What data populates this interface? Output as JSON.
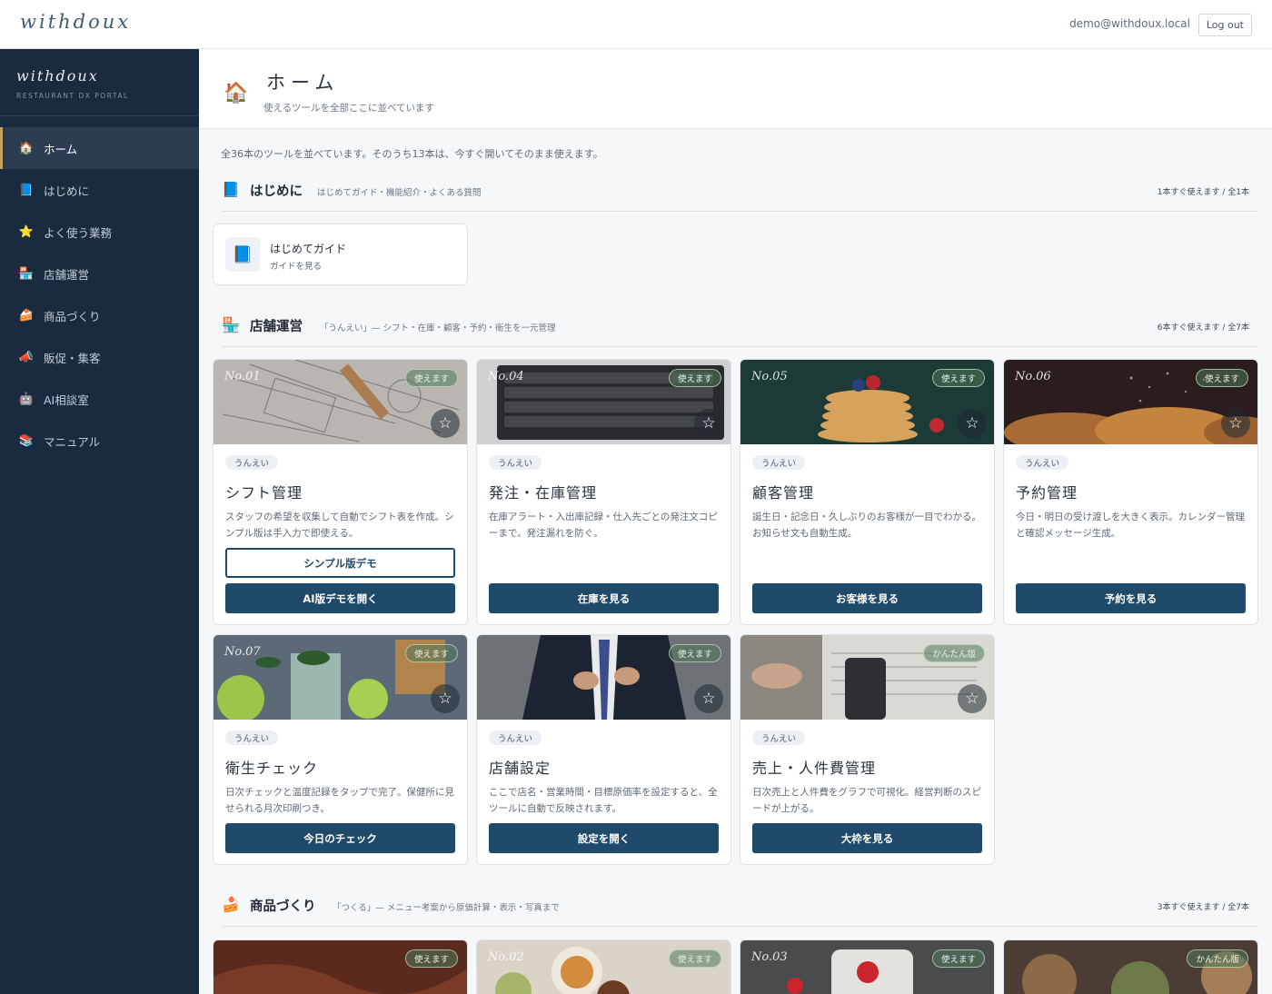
{
  "topbar": {
    "brand": "withdoux",
    "user_email": "demo@withdoux.local",
    "logout_label": "Log out"
  },
  "sidebar": {
    "brand": "withdoux",
    "subtitle": "RESTAURANT DX PORTAL",
    "items": [
      {
        "label": "ホーム",
        "icon": "house-icon",
        "active": true
      },
      {
        "label": "はじめに",
        "icon": "book-icon",
        "active": false
      },
      {
        "label": "よく使う業務",
        "icon": "star-icon",
        "active": false
      },
      {
        "label": "店舗運営",
        "icon": "store-icon",
        "active": false
      },
      {
        "label": "商品づくり",
        "icon": "cake-icon",
        "active": false
      },
      {
        "label": "販促・集客",
        "icon": "megaphone-icon",
        "active": false
      },
      {
        "label": "AI相談室",
        "icon": "robot-icon",
        "active": false
      },
      {
        "label": "マニュアル",
        "icon": "books-icon",
        "active": false
      }
    ]
  },
  "page": {
    "title": "ホーム",
    "subtitle": "使えるツールを全部ここに並べています",
    "summary": "全36本のツールを並べています。そのうち13本は、今すぐ開いてそのまま使えます。"
  },
  "sections": {
    "intro": {
      "title": "はじめに",
      "desc": "はじめてガイド・機能紹介・よくある質問",
      "count": "1本すぐ使えます / 全1本",
      "card": {
        "title": "はじめてガイド",
        "sub": "ガイドを見る"
      }
    },
    "store": {
      "title": "店舗運営",
      "desc": "「うんえい」— シフト・在庫・顧客・予約・衛生を一元管理",
      "count": "6本すぐ使えます / 全7本",
      "cards": [
        {
          "no": "No.01",
          "badge": "使えます",
          "tag": "うんえい",
          "title": "シフト管理",
          "desc": "スタッフの希望を収集して自動でシフト表を作成。シンプル版は手入力で即使える。",
          "secondary": "シンプル版デモ",
          "primary": "AI版デモを開く"
        },
        {
          "no": "No.04",
          "badge": "使えます",
          "tag": "うんえい",
          "title": "発注・在庫管理",
          "desc": "在庫アラート・入出庫記録・仕入先ごとの発注文コピーまで。発注漏れを防ぐ。",
          "primary": "在庫を見る"
        },
        {
          "no": "No.05",
          "badge": "使えます",
          "tag": "うんえい",
          "title": "顧客管理",
          "desc": "誕生日・記念日・久しぶりのお客様が一目でわかる。お知らせ文も自動生成。",
          "primary": "お客様を見る"
        },
        {
          "no": "No.06",
          "badge": "使えます",
          "tag": "うんえい",
          "title": "予約管理",
          "desc": "今日・明日の受け渡しを大きく表示。カレンダー管理と確認メッセージ生成。",
          "primary": "予約を見る"
        },
        {
          "no": "No.07",
          "badge": "使えます",
          "tag": "うんえい",
          "title": "衛生チェック",
          "desc": "日次チェックと温度記録をタップで完了。保健所に見せられる月次印刷つき。",
          "primary": "今日のチェック"
        },
        {
          "no": "",
          "badge": "使えます",
          "tag": "うんえい",
          "title": "店舗設定",
          "desc": "ここで店名・営業時間・目標原価率を設定すると、全ツールに自動で反映されます。",
          "primary": "設定を開く"
        },
        {
          "no": "",
          "badge": "かんたん版",
          "tag": "うんえい",
          "title": "売上・人件費管理",
          "desc": "日次売上と人件費をグラフで可視化。経営判断のスピードが上がる。",
          "primary": "大枠を見る"
        }
      ]
    },
    "product": {
      "title": "商品づくり",
      "desc": "「つくる」— メニュー考案から原価計算・表示・写真まで",
      "count": "3本すぐ使えます / 全7本",
      "cards": [
        {
          "no": "",
          "badge": "使えます"
        },
        {
          "no": "No.02",
          "badge": "使えます"
        },
        {
          "no": "No.03",
          "badge": "使えます"
        },
        {
          "no": "",
          "badge": "かんたん版"
        }
      ]
    }
  },
  "colors": {
    "sidebar_bg": "#1b2b3f",
    "primary_button": "#1f4a6a",
    "active_accent": "#c9a15e"
  }
}
